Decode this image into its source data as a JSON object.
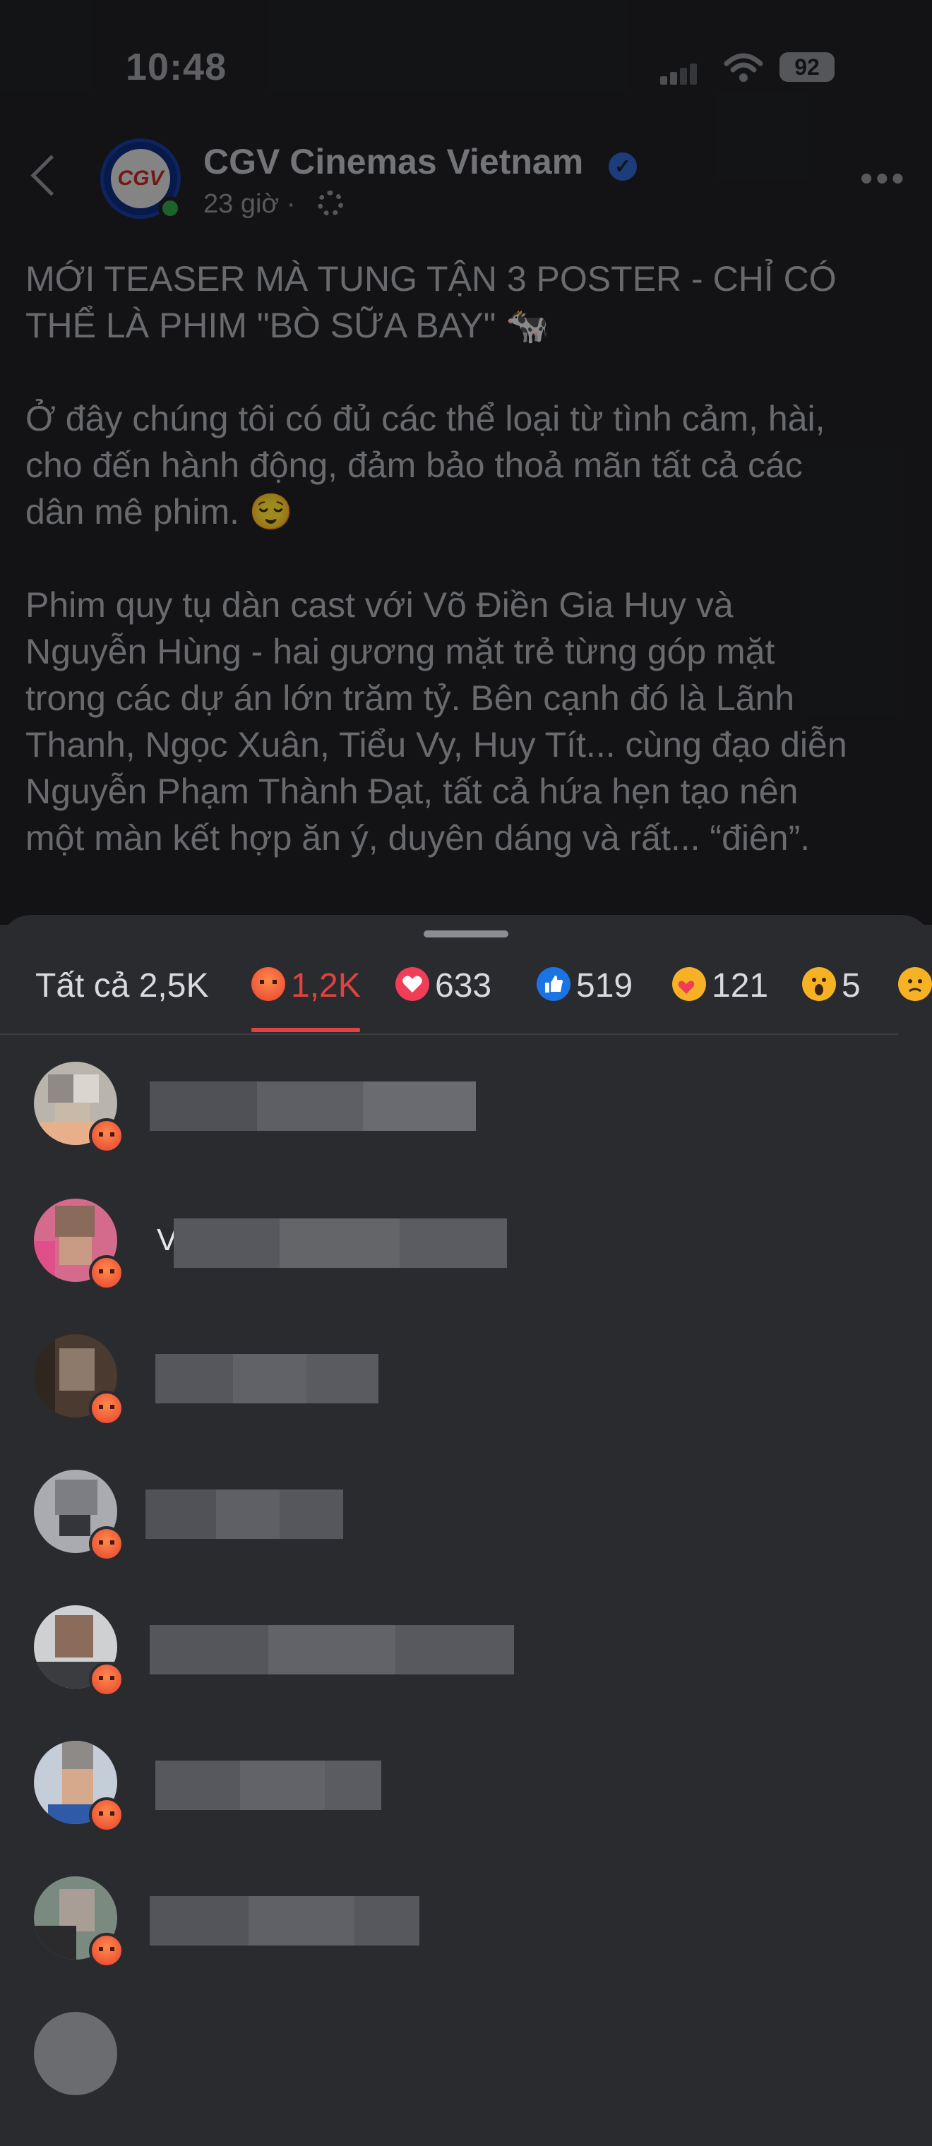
{
  "status_bar": {
    "time": "10:48",
    "battery": "92"
  },
  "post": {
    "page_name": "CGV Cinemas Vietnam",
    "avatar_text": "CGV",
    "timestamp": "23 giờ",
    "separator": "·",
    "text": "MỚI TEASER MÀ TUNG TẬN 3 POSTER - CHỈ CÓ\nTHỂ LÀ PHIM \"BÒ SỮA BAY\" 🐄\n\nỞ đây chúng tôi có đủ các thể loại từ tình cảm, hài,\ncho đến hành động, đảm bảo thoả mãn tất cả các\ndân mê phim. 😌\n\nPhim quy tụ dàn cast với Võ Điền Gia Huy và\nNguyễn Hùng - hai gương mặt trẻ từng góp mặt\ntrong các dự án lớn trăm tỷ. Bên cạnh đó là Lãnh\nThanh, Ngọc Xuân, Tiểu Vy, Huy Tít... cùng đạo diễn\nNguyễn Phạm Thành Đạt, tất cả hứa hẹn tạo nên\nmột màn kết hợp ăn ý, duyên dáng và rất... “điên”."
  },
  "reactions": {
    "tabs": [
      {
        "label": "Tất cả 2,5K",
        "icon": null
      },
      {
        "label": "1,2K",
        "icon": "angry-icon"
      },
      {
        "label": "633",
        "icon": "love-icon"
      },
      {
        "label": "519",
        "icon": "like-icon"
      },
      {
        "label": "121",
        "icon": "care-icon"
      },
      {
        "label": "5",
        "icon": "wow-icon"
      },
      {
        "label": "",
        "icon": "sad-icon"
      }
    ],
    "active_tab": 1,
    "accent_color": "#e0433f",
    "users": [
      {
        "reaction": "angry-icon",
        "name_pixelated": true
      },
      {
        "reaction": "angry-icon",
        "name_pixelated": true,
        "visible_initial": "V"
      },
      {
        "reaction": "angry-icon",
        "name_pixelated": true
      },
      {
        "reaction": "angry-icon",
        "name_pixelated": true
      },
      {
        "reaction": "angry-icon",
        "name_pixelated": true
      },
      {
        "reaction": "angry-icon",
        "name_pixelated": true
      },
      {
        "reaction": "angry-icon",
        "name_pixelated": true
      }
    ]
  }
}
